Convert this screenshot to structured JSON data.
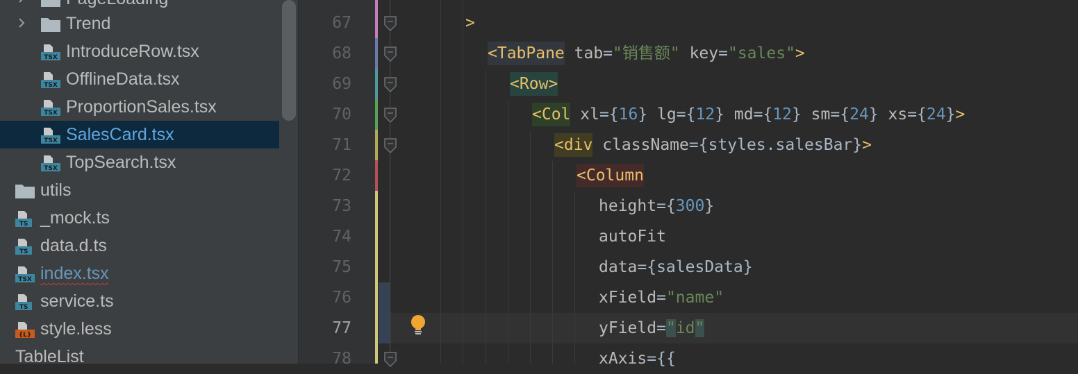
{
  "project_tree": {
    "items": [
      {
        "label": "PageLoading",
        "icon": "folder-icon",
        "kind": "folder"
      },
      {
        "label": "Trend",
        "icon": "folder-icon",
        "kind": "folder"
      },
      {
        "label": "IntroduceRow.tsx",
        "icon": "tsx-file-icon",
        "badge": "TSX"
      },
      {
        "label": "OfflineData.tsx",
        "icon": "tsx-file-icon",
        "badge": "TSX"
      },
      {
        "label": "ProportionSales.tsx",
        "icon": "tsx-file-icon",
        "badge": "TSX"
      },
      {
        "label": "SalesCard.tsx",
        "icon": "tsx-file-icon",
        "badge": "TSX",
        "selected": true
      },
      {
        "label": "TopSearch.tsx",
        "icon": "tsx-file-icon",
        "badge": "TSX"
      },
      {
        "label": "utils",
        "icon": "folder-icon",
        "kind": "folder"
      },
      {
        "label": "_mock.ts",
        "icon": "ts-file-icon",
        "badge": "TS"
      },
      {
        "label": "data.d.ts",
        "icon": "ts-file-icon",
        "badge": "TS"
      },
      {
        "label": "index.tsx",
        "icon": "tsx-file-icon",
        "badge": "TSX",
        "modified": true
      },
      {
        "label": "service.ts",
        "icon": "ts-file-icon",
        "badge": "TS"
      },
      {
        "label": "style.less",
        "icon": "less-file-icon",
        "badge": "{L}"
      },
      {
        "label": "TableList",
        "icon": "folder-icon",
        "kind": "folder"
      }
    ]
  },
  "editor": {
    "line_numbers": [
      "67",
      "68",
      "69",
      "70",
      "71",
      "72",
      "73",
      "74",
      "75",
      "76",
      "77",
      "78"
    ],
    "current_line": "77",
    "lines": [
      {
        "prefix": ">",
        "tag": "",
        "parts": []
      },
      {
        "tag": "<TabPane",
        "parts": [
          {
            "t": "attr",
            "v": " tab"
          },
          {
            "t": "op",
            "v": "="
          },
          {
            "t": "str",
            "v": "\"销售额\""
          },
          {
            "t": "attr",
            "v": " key"
          },
          {
            "t": "op",
            "v": "="
          },
          {
            "t": "str",
            "v": "\"sales\""
          },
          {
            "t": "tag",
            "v": ">"
          }
        ]
      },
      {
        "tag": "<Row",
        "parts": [
          {
            "t": "tag",
            "v": ">"
          }
        ]
      },
      {
        "tag": "<Col",
        "parts": [
          {
            "t": "attr",
            "v": " xl"
          },
          {
            "t": "op",
            "v": "={"
          },
          {
            "t": "num",
            "v": "16"
          },
          {
            "t": "op",
            "v": "}"
          },
          {
            "t": "attr",
            "v": " lg"
          },
          {
            "t": "op",
            "v": "={"
          },
          {
            "t": "num",
            "v": "12"
          },
          {
            "t": "op",
            "v": "}"
          },
          {
            "t": "attr",
            "v": " md"
          },
          {
            "t": "op",
            "v": "={"
          },
          {
            "t": "num",
            "v": "12"
          },
          {
            "t": "op",
            "v": "}"
          },
          {
            "t": "attr",
            "v": " sm"
          },
          {
            "t": "op",
            "v": "={"
          },
          {
            "t": "num",
            "v": "24"
          },
          {
            "t": "op",
            "v": "}"
          },
          {
            "t": "attr",
            "v": " xs"
          },
          {
            "t": "op",
            "v": "={"
          },
          {
            "t": "num",
            "v": "24"
          },
          {
            "t": "op",
            "v": "}"
          },
          {
            "t": "tag",
            "v": ">"
          }
        ]
      },
      {
        "tag": "<div",
        "parts": [
          {
            "t": "attr",
            "v": " className"
          },
          {
            "t": "op",
            "v": "={styles.salesBar}"
          },
          {
            "t": "tag",
            "v": ">"
          }
        ]
      },
      {
        "tag": "<Column",
        "parts": []
      },
      {
        "tag": "",
        "parts": [
          {
            "t": "attr",
            "v": "height"
          },
          {
            "t": "op",
            "v": "={"
          },
          {
            "t": "num",
            "v": "300"
          },
          {
            "t": "op",
            "v": "}"
          }
        ]
      },
      {
        "tag": "",
        "parts": [
          {
            "t": "attr",
            "v": "autoFit"
          }
        ]
      },
      {
        "tag": "",
        "parts": [
          {
            "t": "attr",
            "v": "data"
          },
          {
            "t": "op",
            "v": "={salesData}"
          }
        ]
      },
      {
        "tag": "",
        "parts": [
          {
            "t": "attr",
            "v": "xField"
          },
          {
            "t": "op",
            "v": "="
          },
          {
            "t": "str",
            "v": "\"name\""
          }
        ]
      },
      {
        "tag": "",
        "parts": [
          {
            "t": "attr",
            "v": "yField"
          },
          {
            "t": "op",
            "v": "="
          },
          {
            "t": "str",
            "v": "\"id\""
          }
        ]
      },
      {
        "tag": "",
        "parts": [
          {
            "t": "attr",
            "v": "xAxis"
          },
          {
            "t": "op",
            "v": "={{"
          }
        ]
      }
    ]
  },
  "colors": {
    "sidebar_bg": "#3c3f41",
    "editor_bg": "#2b2b2b",
    "selection_bg": "#0d293e",
    "tag": "#e8bf6a",
    "string": "#6a8759",
    "number": "#6897bb",
    "attribute": "#bababa",
    "lightbulb": "#f0a732"
  }
}
